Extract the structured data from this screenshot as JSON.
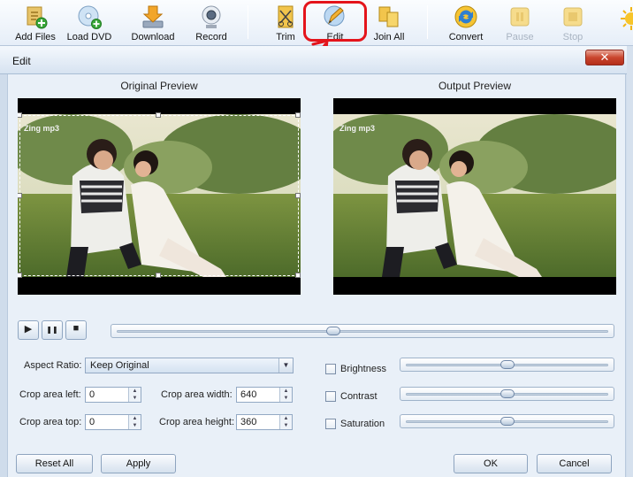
{
  "toolbar": {
    "items": [
      {
        "label": "Add Files",
        "icon": "add-files-icon",
        "enabled": true
      },
      {
        "label": "Load DVD",
        "icon": "load-dvd-icon",
        "enabled": true
      },
      {
        "label": "Download",
        "icon": "download-icon",
        "enabled": true
      },
      {
        "label": "Record",
        "icon": "record-icon",
        "enabled": true
      },
      {
        "label": "Trim",
        "icon": "trim-icon",
        "enabled": true
      },
      {
        "label": "Edit",
        "icon": "edit-icon",
        "enabled": true
      },
      {
        "label": "Join All",
        "icon": "join-all-icon",
        "enabled": true
      },
      {
        "label": "Convert",
        "icon": "convert-icon",
        "enabled": true
      },
      {
        "label": "Pause",
        "icon": "pause-icon",
        "enabled": false
      },
      {
        "label": "Stop",
        "icon": "stop-icon",
        "enabled": false
      }
    ],
    "highlight_color": "#e4141b"
  },
  "window": {
    "title": "Edit",
    "close_glyph": "✕"
  },
  "preview": {
    "original_title": "Original Preview",
    "output_title": "Output Preview",
    "watermark": "Zing mp3"
  },
  "transport": {
    "play_glyph": "▶",
    "pause_glyph": "❚❚",
    "stop_glyph": "■",
    "position_fraction": 0.44
  },
  "crop": {
    "aspect_ratio_label": "Aspect Ratio:",
    "aspect_ratio_value": "Keep Original",
    "left_label": "Crop area left:",
    "left_value": "0",
    "top_label": "Crop area top:",
    "top_value": "0",
    "width_label": "Crop area width:",
    "width_value": "640",
    "height_label": "Crop area height:",
    "height_value": "360"
  },
  "effects": {
    "brightness_label": "Brightness",
    "contrast_label": "Contrast",
    "saturation_label": "Saturation",
    "brightness_fraction": 0.5,
    "contrast_fraction": 0.5,
    "saturation_fraction": 0.5
  },
  "buttons": {
    "reset_all": "Reset All",
    "apply": "Apply",
    "ok": "OK",
    "cancel": "Cancel"
  }
}
